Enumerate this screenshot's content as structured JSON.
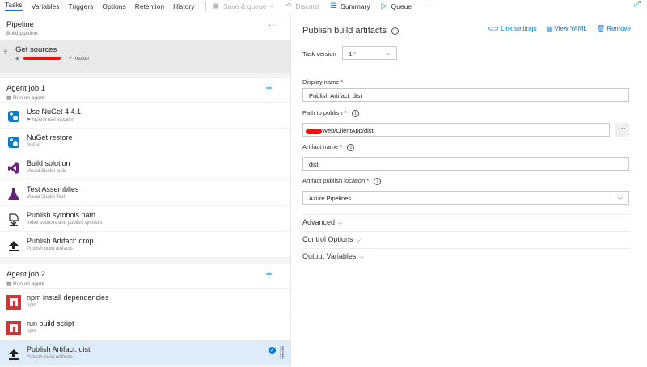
{
  "topbar": {
    "tabs": [
      "Tasks",
      "Variables",
      "Triggers",
      "Options",
      "Retention",
      "History"
    ],
    "save_label": "Save & queue",
    "discard_label": "Discard",
    "summary_label": "Summary",
    "queue_label": "Queue",
    "more_label": "···"
  },
  "pipeline": {
    "title": "Pipeline",
    "subtitle": "Build pipeline",
    "more_label": "···"
  },
  "get_sources": {
    "title": "Get sources",
    "branch": "master"
  },
  "agent_jobs": [
    {
      "title": "Agent job 1",
      "subtitle": "Run on agent",
      "tasks": [
        {
          "title": "Use NuGet 4.4.1",
          "subtitle": "NuGet tool installer",
          "icon": "nuget-icon"
        },
        {
          "title": "NuGet restore",
          "subtitle": "NuGet",
          "icon": "nuget-icon"
        },
        {
          "title": "Build solution",
          "subtitle": "Visual Studio build",
          "icon": "visual-studio-icon"
        },
        {
          "title": "Test Assemblies",
          "subtitle": "Visual Studio Test",
          "icon": "flask-icon"
        },
        {
          "title": "Publish symbols path",
          "subtitle": "Index sources and publish symbols",
          "icon": "symbols-icon"
        },
        {
          "title": "Publish Artifact: drop",
          "subtitle": "Publish build artifacts",
          "icon": "upload-icon"
        }
      ]
    },
    {
      "title": "Agent job 2",
      "subtitle": "Run on agent",
      "tasks": [
        {
          "title": "npm install dependencies",
          "subtitle": "npm",
          "icon": "npm-icon"
        },
        {
          "title": "run build script",
          "subtitle": "npm",
          "icon": "npm-icon"
        },
        {
          "title": "Publish Artifact: dist",
          "subtitle": "Publish build artifacts",
          "icon": "upload-icon"
        }
      ]
    }
  ],
  "details": {
    "title": "Publish build artifacts",
    "actions": {
      "link_settings": "Link settings",
      "view_yaml": "View YAML",
      "remove": "Remove"
    },
    "task_version_label": "Task version",
    "task_version_value": "1.*",
    "display_name_label": "Display name",
    "display_name_value": "Publish Artifact: dist",
    "path_label": "Path to publish",
    "path_value": "Web/ClientApp/dist",
    "browse_label": "···",
    "artifact_name_label": "Artifact name",
    "artifact_name_value": "dist",
    "location_label": "Artifact publish location",
    "location_value": "Azure Pipelines",
    "sections": [
      "Advanced",
      "Control Options",
      "Output Variables"
    ]
  },
  "colors": {
    "accent": "#0078d4",
    "selected_row": "#deecf9",
    "npm_red": "#cb3837",
    "vs_purple": "#68217a"
  }
}
